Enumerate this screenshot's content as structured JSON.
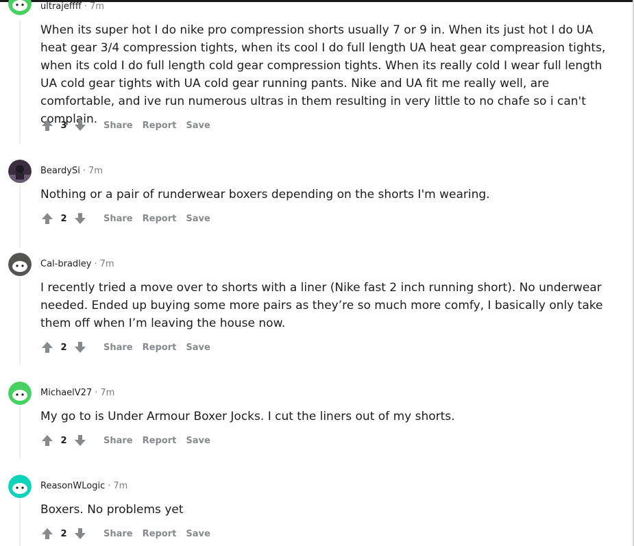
{
  "comments": [
    {
      "author": "ultrajeffff",
      "time": "7m",
      "body": "When its super hot I do nike pro compression shorts usually 7 or 9 in. When its just hot I do UA heat gear 3/4 compression tights, when its cool I do full length UA heat gear compreasion tights, when its cold I do full length cold gear compression tights. When its really cold I wear full length UA cold gear tights with UA cold gear running pants. Nike and UA fit me really well, are comfortable, and ive run numerous ultras in them resulting in very little to no chafe so i can't complain.",
      "score": "3",
      "share": "Share",
      "report": "Report",
      "save": "Save",
      "avatar_color": "#46d160"
    },
    {
      "author": "BeardySi",
      "time": "7m",
      "body": "Nothing or a pair of runderwear boxers depending on the shorts I'm wearing.",
      "score": "2",
      "share": "Share",
      "report": "Report",
      "save": "Save",
      "avatar_color": "#3b2f3f"
    },
    {
      "author": "Cal-bradley",
      "time": "7m",
      "body": "I recently tried a move over to shorts with a liner (Nike fast 2 inch running short). No underwear needed. Ended up buying some more pairs as they’re so much more comfy, I basically only take them off when I’m leaving the house now.",
      "score": "2",
      "share": "Share",
      "report": "Report",
      "save": "Save",
      "avatar_color": "#545452"
    },
    {
      "author": "MichaelV27",
      "time": "7m",
      "body": "My go to is Under Armour Boxer Jocks. I cut the liners out of my shorts.",
      "score": "2",
      "share": "Share",
      "report": "Report",
      "save": "Save",
      "avatar_color": "#46d160"
    },
    {
      "author": "ReasonWLogic",
      "time": "7m",
      "body": "Boxers. No problems yet",
      "score": "2",
      "share": "Share",
      "report": "Report",
      "save": "Save",
      "avatar_color": "#0dd3bb"
    }
  ],
  "colors": {
    "meta_gray": "#7c7c7c",
    "action_gray": "#878a8c",
    "text": "#1c1c1c"
  },
  "icons": {
    "upvote": "arrow-up-icon",
    "downvote": "arrow-down-icon",
    "avatar": "snoo-avatar-icon"
  }
}
